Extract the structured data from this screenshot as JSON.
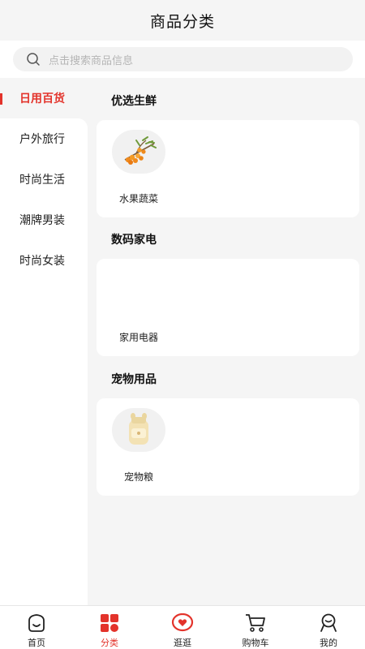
{
  "header": {
    "title": "商品分类"
  },
  "search": {
    "placeholder": "点击搜索商品信息"
  },
  "sidebar": {
    "items": [
      {
        "label": "日用百货",
        "active": true
      },
      {
        "label": "户外旅行"
      },
      {
        "label": "时尚生活"
      },
      {
        "label": "潮牌男装"
      },
      {
        "label": "时尚女装"
      }
    ]
  },
  "sections": [
    {
      "title": "优选生鲜",
      "items": [
        {
          "label": "水果蔬菜",
          "icon": "sea-buckthorn-fruit-image"
        }
      ]
    },
    {
      "title": "数码家电",
      "items": [
        {
          "label": "家用电器",
          "icon": ""
        }
      ]
    },
    {
      "title": "宠物用品",
      "items": [
        {
          "label": "宠物粮",
          "icon": "pet-food-jar-image"
        }
      ]
    }
  ],
  "tabbar": {
    "items": [
      {
        "label": "首页",
        "icon": "home-face-icon"
      },
      {
        "label": "分类",
        "icon": "category-grid-icon",
        "active": true
      },
      {
        "label": "逛逛",
        "icon": "heart-bubble-icon"
      },
      {
        "label": "购物车",
        "icon": "cart-icon"
      },
      {
        "label": "我的",
        "icon": "profile-icon"
      }
    ]
  },
  "colors": {
    "accent": "#e3332b",
    "background": "#f5f5f5",
    "card": "#ffffff"
  }
}
